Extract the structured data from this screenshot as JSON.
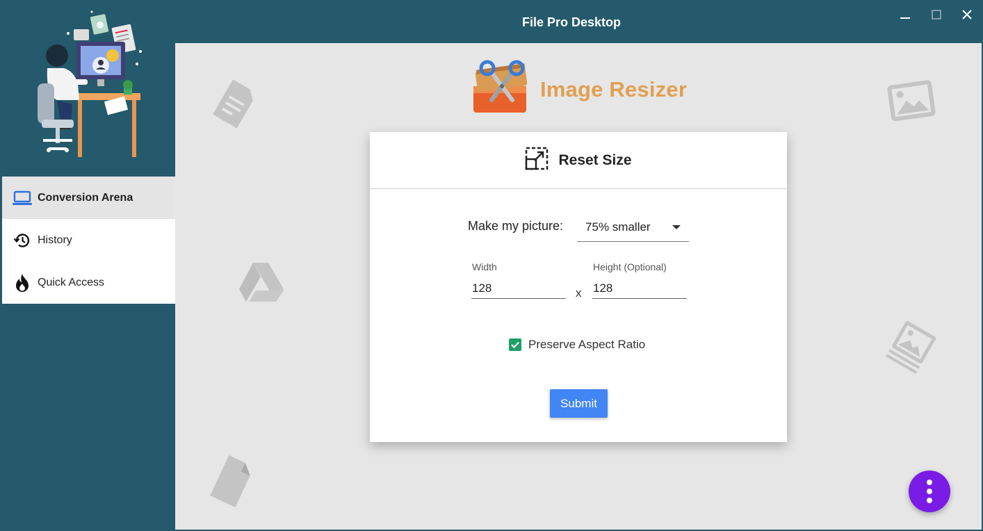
{
  "window": {
    "title": "File Pro Desktop",
    "controls": [
      "minimize-icon",
      "maximize-icon",
      "close-icon"
    ]
  },
  "sidebar": {
    "items": [
      {
        "label": "Conversion Arena",
        "icon": "laptop-icon",
        "active": true
      },
      {
        "label": "History",
        "icon": "history-icon",
        "active": false
      },
      {
        "label": "Quick Access",
        "icon": "flame-icon",
        "active": false
      }
    ]
  },
  "main": {
    "logo_text": "Image Resizer",
    "card": {
      "title": "Reset Size",
      "make_label": "Make my picture:",
      "size_option": "75% smaller",
      "width_label": "Width",
      "width_value": "128",
      "separator": "x",
      "height_label": "Height (Optional)",
      "height_value": "128",
      "preserve_label": "Preserve Aspect Ratio",
      "preserve_checked": true,
      "submit_label": "Submit"
    }
  },
  "colors": {
    "primary": "#245a6b",
    "background": "#e6e6e6",
    "accent_logo": "#e0a052",
    "submit": "#4285f4",
    "checkbox": "#1f9e67",
    "fab": "#7a1ce6"
  }
}
